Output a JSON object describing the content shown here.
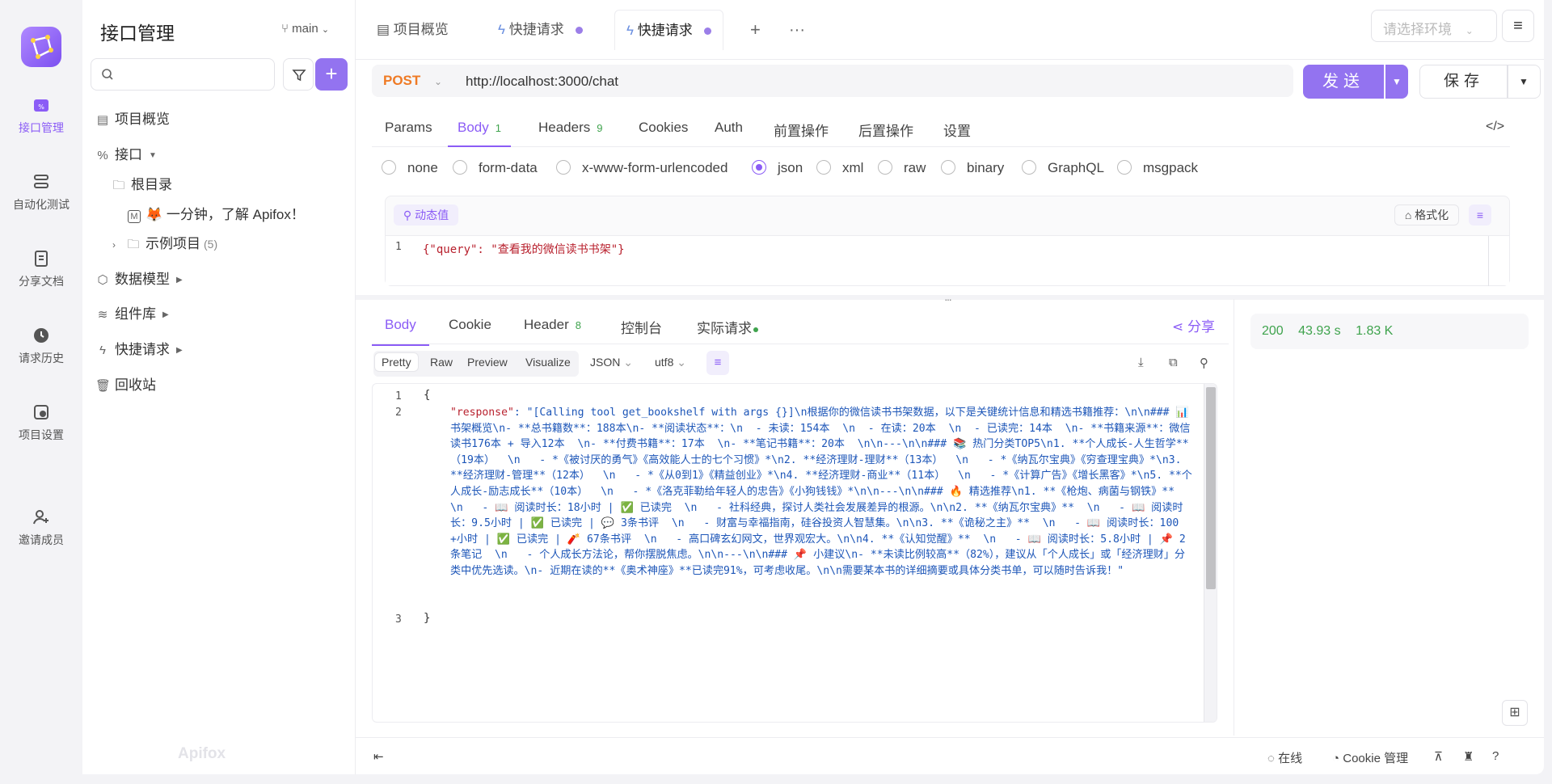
{
  "rail": {
    "items": [
      {
        "label": "接口管理",
        "icon": "api-icon"
      },
      {
        "label": "自动化测试",
        "icon": "automation-icon"
      },
      {
        "label": "分享文档",
        "icon": "share-doc-icon"
      },
      {
        "label": "请求历史",
        "icon": "history-icon"
      },
      {
        "label": "项目设置",
        "icon": "settings-icon"
      },
      {
        "label": "邀请成员",
        "icon": "invite-icon"
      }
    ]
  },
  "tree": {
    "title": "接口管理",
    "branch": "main",
    "nodes": {
      "overview": "项目概览",
      "interfaces": "接口",
      "root": "根目录",
      "doc": "🦊 一分钟，了解 Apifox！",
      "examples": "示例项目",
      "examples_count": "(5)",
      "models": "数据模型",
      "components": "组件库",
      "quick": "快捷请求",
      "trash": "回收站"
    },
    "watermark": "Apifox"
  },
  "tabs": {
    "items": [
      "项目概览",
      "快捷请求",
      "快捷请求"
    ],
    "env_placeholder": "请选择环境"
  },
  "request": {
    "method": "POST",
    "url": "http://localhost:3000/chat",
    "send_label": "发送",
    "save_label": "保存",
    "subtabs": {
      "params": "Params",
      "body": "Body",
      "body_count": "1",
      "headers": "Headers",
      "headers_count": "9",
      "cookies": "Cookies",
      "auth": "Auth",
      "pre": "前置操作",
      "post": "后置操作",
      "settings": "设置"
    },
    "body_types": [
      "none",
      "form-data",
      "x-www-form-urlencoded",
      "json",
      "xml",
      "raw",
      "binary",
      "GraphQL",
      "msgpack"
    ],
    "selected_body_type": "json",
    "dynamic_label": "动态值",
    "format_label": "格式化",
    "line1": "1",
    "body_code": "{\"query\": \"查看我的微信读书书架\"}"
  },
  "response": {
    "tabs": {
      "body": "Body",
      "cookie": "Cookie",
      "header": "Header",
      "header_count": "8",
      "console": "控制台",
      "actual": "实际请求"
    },
    "share_label": "分享",
    "views": {
      "pretty": "Pretty",
      "raw": "Raw",
      "preview": "Preview",
      "visualize": "Visualize"
    },
    "format": "JSON",
    "encoding": "utf8",
    "lines": [
      "1",
      "2",
      "3"
    ],
    "open_brace": "{",
    "close_brace": "}",
    "key": "\"response\"",
    "value": ": \"[Calling tool get_bookshelf with args {}]\\n根据你的微信读书书架数据，以下是关键统计信息和精选书籍推荐：\\n\\n### 📊 书架概览\\n- **总书籍数**：188本\\n- **阅读状态**：\\n  - 未读：154本  \\n  - 在读：20本  \\n  - 已读完：14本  \\n- **书籍来源**：微信读书176本 + 导入12本  \\n- **付费书籍**：17本  \\n- **笔记书籍**：20本  \\n\\n---\\n\\n### 📚 热门分类TOP5\\n1. **个人成长-人生哲学**（19本）  \\n   - *《被讨厌的勇气》《高效能人士的七个习惯》*\\n2. **经济理财-理财**（13本）  \\n   - *《纳瓦尔宝典》《穷查理宝典》*\\n3. **经济理财-管理**（12本）  \\n   - *《从0到1》《精益创业》*\\n4. **经济理财-商业**（11本）  \\n   - *《计算广告》《增长黑客》*\\n5. **个人成长-励志成长**（10本）  \\n   - *《洛克菲勒给年轻人的忠告》《小狗钱钱》*\\n\\n---\\n\\n### 🔥 精选推荐\\n1. **《枪炮、病菌与钢铁》**  \\n   - 📖 阅读时长：18小时 | ✅ 已读完  \\n   - 社科经典，探讨人类社会发展差异的根源。\\n\\n2. **《纳瓦尔宝典》**  \\n   - 📖 阅读时长：9.5小时 | ✅ 已读完 | 💬 3条书评  \\n   - 财富与幸福指南，硅谷投资人智慧集。\\n\\n3. **《诡秘之主》**  \\n   - 📖 阅读时长：100+小时 | ✅ 已读完 | 🧨 67条书评  \\n   - 高口碑玄幻网文，世界观宏大。\\n\\n4. **《认知觉醒》**  \\n   - 📖 阅读时长：5.8小时 | 📌 2条笔记  \\n   - 个人成长方法论，帮你摆脱焦虑。\\n\\n---\\n\\n### 📌 小建议\\n- **未读比例较高**（82%），建议从「个人成长」或「经济理财」分类中优先选读。\\n- 近期在读的**《奥术神座》**已读完91%，可考虑收尾。\\n\\n需要某本书的详细摘要或具体分类书单，可以随时告诉我！\"",
    "status": "200",
    "time": "43.93 s",
    "size": "1.83 K"
  },
  "statusbar": {
    "online": "在线",
    "cookie": "Cookie 管理"
  }
}
